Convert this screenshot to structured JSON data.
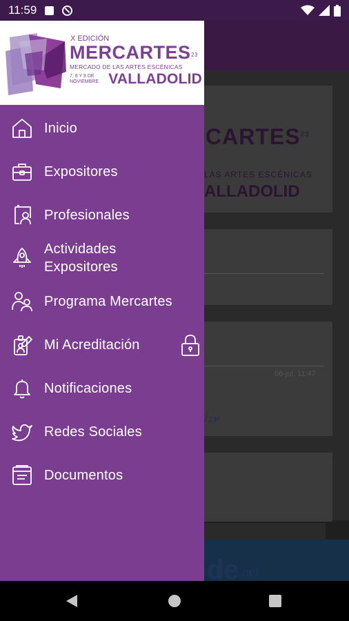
{
  "status_bar": {
    "time": "11:59"
  },
  "background_app": {
    "brand_fragment": "CARTES",
    "brand_superscript": "23",
    "subtitle_fragment": "LAS ARTES ESCÉNICAS",
    "city_fragment": "ALLADOLID",
    "post_date": "06-jul. 11:47",
    "fraction_fragment": "/",
    "fraction_small": "23º",
    "ad_text": "de",
    "ad_suffix": ".net"
  },
  "drawer": {
    "logo": {
      "edition": "X EDICIÓN",
      "name": "MERCARTES",
      "superscript": "23",
      "subtitle": "MERCADO DE LAS ARTES ESCÉNICAS",
      "dates_line1": "7, 8 Y 9 DE",
      "dates_line2": "NOVIEMBRE",
      "city": "VALLADOLID"
    },
    "menu": [
      {
        "id": "inicio",
        "label": "Inicio",
        "icon": "home-icon"
      },
      {
        "id": "expositores",
        "label": "Expositores",
        "icon": "briefcase-icon"
      },
      {
        "id": "profesionales",
        "label": "Profesionales",
        "icon": "presenter-icon"
      },
      {
        "id": "actividades",
        "label_line1": "Actividades",
        "label_line2": "Expositores",
        "icon": "rocket-icon"
      },
      {
        "id": "programa",
        "label": "Programa Mercartes",
        "icon": "people-icon"
      },
      {
        "id": "acreditacion",
        "label": "Mi Acreditación",
        "icon": "accreditation-icon",
        "locked": true
      },
      {
        "id": "notificaciones",
        "label": "Notificaciones",
        "icon": "bell-icon"
      },
      {
        "id": "redes",
        "label": "Redes Sociales",
        "icon": "twitter-icon"
      },
      {
        "id": "documentos",
        "label": "Documentos",
        "icon": "document-icon"
      }
    ]
  },
  "colors": {
    "drawer_bg": "#7a3d90",
    "brand": "#7d3f96",
    "status_bar": "#3d1a4c"
  }
}
